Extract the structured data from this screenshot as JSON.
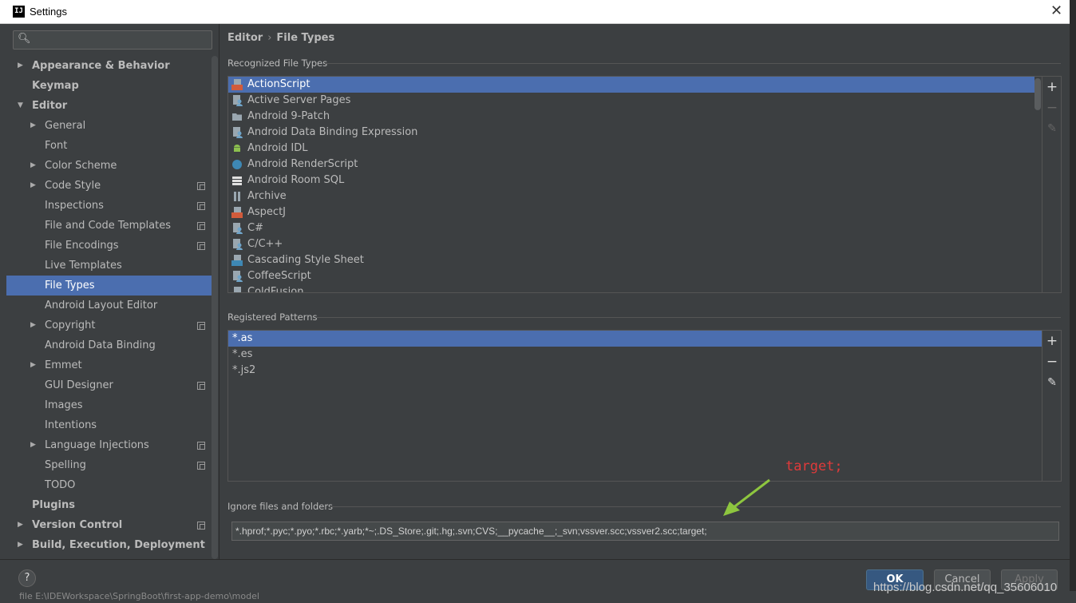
{
  "window": {
    "title": "Settings",
    "logo": "IJ"
  },
  "search": {
    "placeholder": ""
  },
  "sidebar": {
    "items": [
      {
        "label": "Appearance & Behavior",
        "level": 0,
        "arrow": "right",
        "bold": true
      },
      {
        "label": "Keymap",
        "level": 0,
        "arrow": "",
        "bold": true
      },
      {
        "label": "Editor",
        "level": 0,
        "arrow": "down",
        "bold": true
      },
      {
        "label": "General",
        "level": 1,
        "arrow": "right"
      },
      {
        "label": "Font",
        "level": 1,
        "arrow": ""
      },
      {
        "label": "Color Scheme",
        "level": 1,
        "arrow": "right"
      },
      {
        "label": "Code Style",
        "level": 1,
        "arrow": "right",
        "badge": true
      },
      {
        "label": "Inspections",
        "level": 1,
        "arrow": "",
        "badge": true
      },
      {
        "label": "File and Code Templates",
        "level": 1,
        "arrow": "",
        "badge": true
      },
      {
        "label": "File Encodings",
        "level": 1,
        "arrow": "",
        "badge": true
      },
      {
        "label": "Live Templates",
        "level": 1,
        "arrow": ""
      },
      {
        "label": "File Types",
        "level": 1,
        "arrow": "",
        "selected": true
      },
      {
        "label": "Android Layout Editor",
        "level": 1,
        "arrow": ""
      },
      {
        "label": "Copyright",
        "level": 1,
        "arrow": "right",
        "badge": true
      },
      {
        "label": "Android Data Binding",
        "level": 1,
        "arrow": ""
      },
      {
        "label": "Emmet",
        "level": 1,
        "arrow": "right"
      },
      {
        "label": "GUI Designer",
        "level": 1,
        "arrow": "",
        "badge": true
      },
      {
        "label": "Images",
        "level": 1,
        "arrow": ""
      },
      {
        "label": "Intentions",
        "level": 1,
        "arrow": ""
      },
      {
        "label": "Language Injections",
        "level": 1,
        "arrow": "right",
        "badge": true
      },
      {
        "label": "Spelling",
        "level": 1,
        "arrow": "",
        "badge": true
      },
      {
        "label": "TODO",
        "level": 1,
        "arrow": ""
      },
      {
        "label": "Plugins",
        "level": 0,
        "arrow": "",
        "bold": true
      },
      {
        "label": "Version Control",
        "level": 0,
        "arrow": "right",
        "bold": true,
        "badge": true
      },
      {
        "label": "Build, Execution, Deployment",
        "level": 0,
        "arrow": "right",
        "bold": true
      }
    ]
  },
  "breadcrumb": {
    "parent": "Editor",
    "current": "File Types"
  },
  "recognized": {
    "title": "Recognized File Types",
    "items": [
      {
        "label": "ActionScript",
        "icon": "actionscript-icon",
        "color": "#d25b3b",
        "selected": true
      },
      {
        "label": "Active Server Pages",
        "icon": "file-person-icon",
        "color": "#6fa4c9"
      },
      {
        "label": "Android 9-Patch",
        "icon": "folder-icon",
        "color": "#9aa7b0"
      },
      {
        "label": "Android Data Binding Expression",
        "icon": "file-person-icon",
        "color": "#6fa4c9"
      },
      {
        "label": "Android IDL",
        "icon": "android-icon",
        "color": "#8cc04f"
      },
      {
        "label": "Android RenderScript",
        "icon": "renderscript-icon",
        "color": "#3e88b4"
      },
      {
        "label": "Android Room SQL",
        "icon": "table-icon",
        "color": "#e0e0e0"
      },
      {
        "label": "Archive",
        "icon": "archive-icon",
        "color": "#9aa7b0"
      },
      {
        "label": "AspectJ",
        "icon": "aspectj-icon",
        "color": "#d25b3b"
      },
      {
        "label": "C#",
        "icon": "file-person-icon",
        "color": "#6fa4c9"
      },
      {
        "label": "C/C++",
        "icon": "file-person-icon",
        "color": "#6fa4c9"
      },
      {
        "label": "Cascading Style Sheet",
        "icon": "css-icon",
        "color": "#3e88b4"
      },
      {
        "label": "CoffeeScript",
        "icon": "file-person-icon",
        "color": "#6fa4c9"
      },
      {
        "label": "ColdFusion",
        "icon": "coldfusion-icon",
        "color": "#3e88b4"
      }
    ]
  },
  "patterns": {
    "title": "Registered Patterns",
    "items": [
      {
        "label": "*.as",
        "selected": true
      },
      {
        "label": "*.es"
      },
      {
        "label": "*.js2"
      }
    ]
  },
  "ignore": {
    "title": "Ignore files and folders",
    "value": "*.hprof;*.pyc;*.pyo;*.rbc;*.yarb;*~;.DS_Store;.git;.hg;.svn;CVS;__pycache__;_svn;vssver.scc;vssver2.scc;target;"
  },
  "annotation": {
    "text": "target;",
    "color": "#e03a3a",
    "arrow_color": "#8ec63f"
  },
  "tools": {
    "add": "+",
    "remove": "−",
    "edit": "✎"
  },
  "footer": {
    "help": "?",
    "ok": "OK",
    "cancel": "Cancel",
    "apply": "Apply"
  },
  "background": {
    "path_text": "file E:\\IDEWorkspace\\SpringBoot\\first-app-demo\\model"
  },
  "watermark": "https://blog.csdn.net/qq_35606010",
  "colors": {
    "selection": "#4b6eaf",
    "panel": "#3c3f41",
    "primary_button": "#365880"
  }
}
